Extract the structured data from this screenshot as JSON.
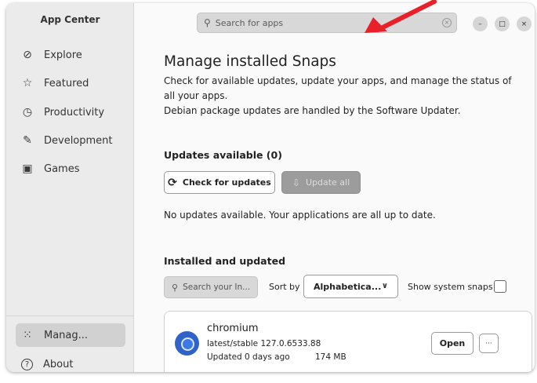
{
  "sidebar": {
    "app_title": "App Center",
    "items": [
      {
        "label": "Explore",
        "icon": "compass-icon",
        "glyph": "⊘"
      },
      {
        "label": "Featured",
        "icon": "star-icon",
        "glyph": "☆"
      },
      {
        "label": "Productivity",
        "icon": "clock-icon",
        "glyph": "◷"
      },
      {
        "label": "Development",
        "icon": "wrench-icon",
        "glyph": "✎"
      },
      {
        "label": "Games",
        "icon": "gamepad-icon",
        "glyph": "▣"
      }
    ],
    "bottom_items": [
      {
        "label": "Manag...",
        "icon": "grid-icon",
        "glyph": "⁙",
        "active": true
      },
      {
        "label": "About",
        "icon": "question-icon",
        "glyph": "?"
      }
    ]
  },
  "header": {
    "search_placeholder": "Search for apps",
    "window_buttons": {
      "minimize": "–",
      "maximize": "□",
      "close": "×"
    }
  },
  "main": {
    "title": "Manage installed Snaps",
    "description": [
      "Check for available updates, update your apps, and manage the status of all your apps.",
      "Debian package updates are handled by the Software Updater."
    ],
    "updates_title": "Updates available (0)",
    "check_button": "Check for updates",
    "update_all_button": "Update all",
    "no_updates_text": "No updates available. Your applications are all up to date.",
    "installed_title": "Installed and updated",
    "search_installed_placeholder": "Search your In...",
    "sort_by_label": "Sort by",
    "sort_value": "Alphabetica...",
    "show_system_label": "Show system snaps",
    "apps": [
      {
        "name": "chromium",
        "channel": "latest/stable 127.0.6533.88",
        "updated": "Updated 0 days ago",
        "size": "174 MB",
        "open_label": "Open",
        "more_label": "···"
      }
    ]
  },
  "colors": {
    "accent_arrow": "#e8202a",
    "sidebar_bg": "#ebebeb",
    "active_item": "#d1d1d1",
    "chromium_blue": "#2f63c7"
  }
}
